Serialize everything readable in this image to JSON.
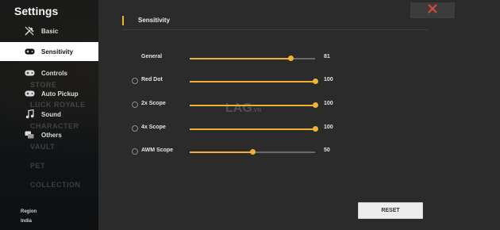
{
  "sidebar": {
    "title": "Settings",
    "items": [
      {
        "label": "Basic",
        "icon": "wrench-screwdriver-icon",
        "active": false
      },
      {
        "label": "Sensitivity",
        "icon": "gamepad-icon",
        "active": true
      },
      {
        "label": "Controls",
        "icon": "gamepad-icon",
        "active": false
      },
      {
        "label": "Auto Pickup",
        "icon": "gamepad-icon",
        "active": false
      },
      {
        "label": "Sound",
        "icon": "music-note-icon",
        "active": false
      },
      {
        "label": "Others",
        "icon": "chat-icon",
        "active": false
      }
    ],
    "background_labels": [
      "STORE",
      "LUCK ROYALE",
      "CHARACTER",
      "VAULT",
      "PET",
      "COLLECTION"
    ],
    "region_label": "Region",
    "region_value": "India"
  },
  "panel": {
    "title": "Sensitivity",
    "close_icon": "close-x-icon",
    "sliders": [
      {
        "label": "General",
        "value": 81,
        "max": 100,
        "has_checkbox": false
      },
      {
        "label": "Red Dot",
        "value": 100,
        "max": 100,
        "has_checkbox": true
      },
      {
        "label": "2x Scope",
        "value": 100,
        "max": 100,
        "has_checkbox": true
      },
      {
        "label": "4x Scope",
        "value": 100,
        "max": 100,
        "has_checkbox": true
      },
      {
        "label": "AWM Scope",
        "value": 50,
        "max": 100,
        "has_checkbox": true
      }
    ],
    "reset_label": "RESET"
  },
  "watermark": {
    "main": "LAG",
    "suffix": ".VN"
  },
  "colors": {
    "accent": "#f2b233",
    "active_bg": "#ffffff",
    "close": "#e0483a"
  }
}
